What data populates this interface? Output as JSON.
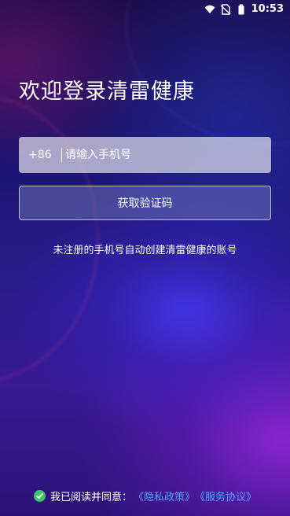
{
  "status_bar": {
    "time": "10:53",
    "icons": [
      "wifi-icon",
      "no-sim-icon",
      "battery-icon"
    ]
  },
  "welcome": {
    "title": "欢迎登录清雷健康"
  },
  "login": {
    "country_code": "+86",
    "phone_placeholder": "请输入手机号",
    "phone_value": "",
    "get_code_label": "获取验证码",
    "notice": "未注册的手机号自动创建清雷健康的账号"
  },
  "agreement": {
    "checked": true,
    "text": "我已阅读并同意：",
    "privacy_label": "《隐私政策》",
    "service_label": "《服务协议》"
  },
  "colors": {
    "link": "#4fa3ff",
    "check": "#3cc36b"
  }
}
